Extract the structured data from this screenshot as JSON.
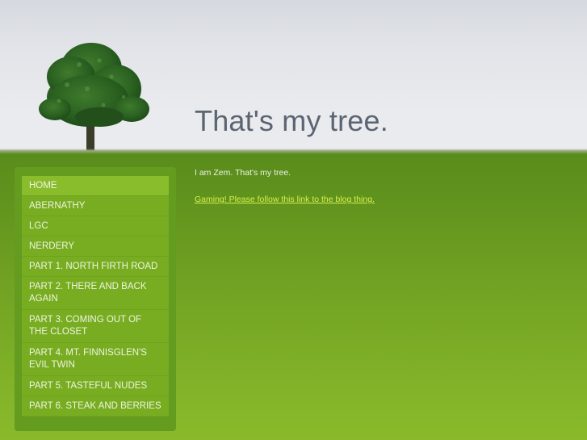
{
  "header": {
    "title": "That's my tree.",
    "logo": "tree-image"
  },
  "sidebar": {
    "items": [
      {
        "label": "HOME",
        "active": true
      },
      {
        "label": "ABERNATHY",
        "active": false
      },
      {
        "label": "LGC",
        "active": false
      },
      {
        "label": "NERDERY",
        "active": false
      },
      {
        "label": "PART 1. NORTH FIRTH ROAD",
        "active": false
      },
      {
        "label": "PART 2. THERE AND BACK AGAIN",
        "active": false
      },
      {
        "label": "PART 3. COMING OUT OF THE CLOSET",
        "active": false
      },
      {
        "label": "PART 4. MT. FINNISGLEN'S EVIL TWIN",
        "active": false
      },
      {
        "label": "PART 5. TASTEFUL NUDES",
        "active": false
      },
      {
        "label": "PART 6. STEAK AND BERRIES",
        "active": false
      }
    ]
  },
  "content": {
    "intro": "I am Zem. That's my tree.",
    "link_text": "Gaming! Please follow this link to the blog thing."
  },
  "colors": {
    "sky": "#e9ebee",
    "grass_top": "#5a8c1c",
    "grass_bottom": "#8aba2b",
    "nav_item": "#78ad22",
    "nav_active": "#8abd2b",
    "link": "#d6ef4c",
    "title": "#5b6572"
  }
}
